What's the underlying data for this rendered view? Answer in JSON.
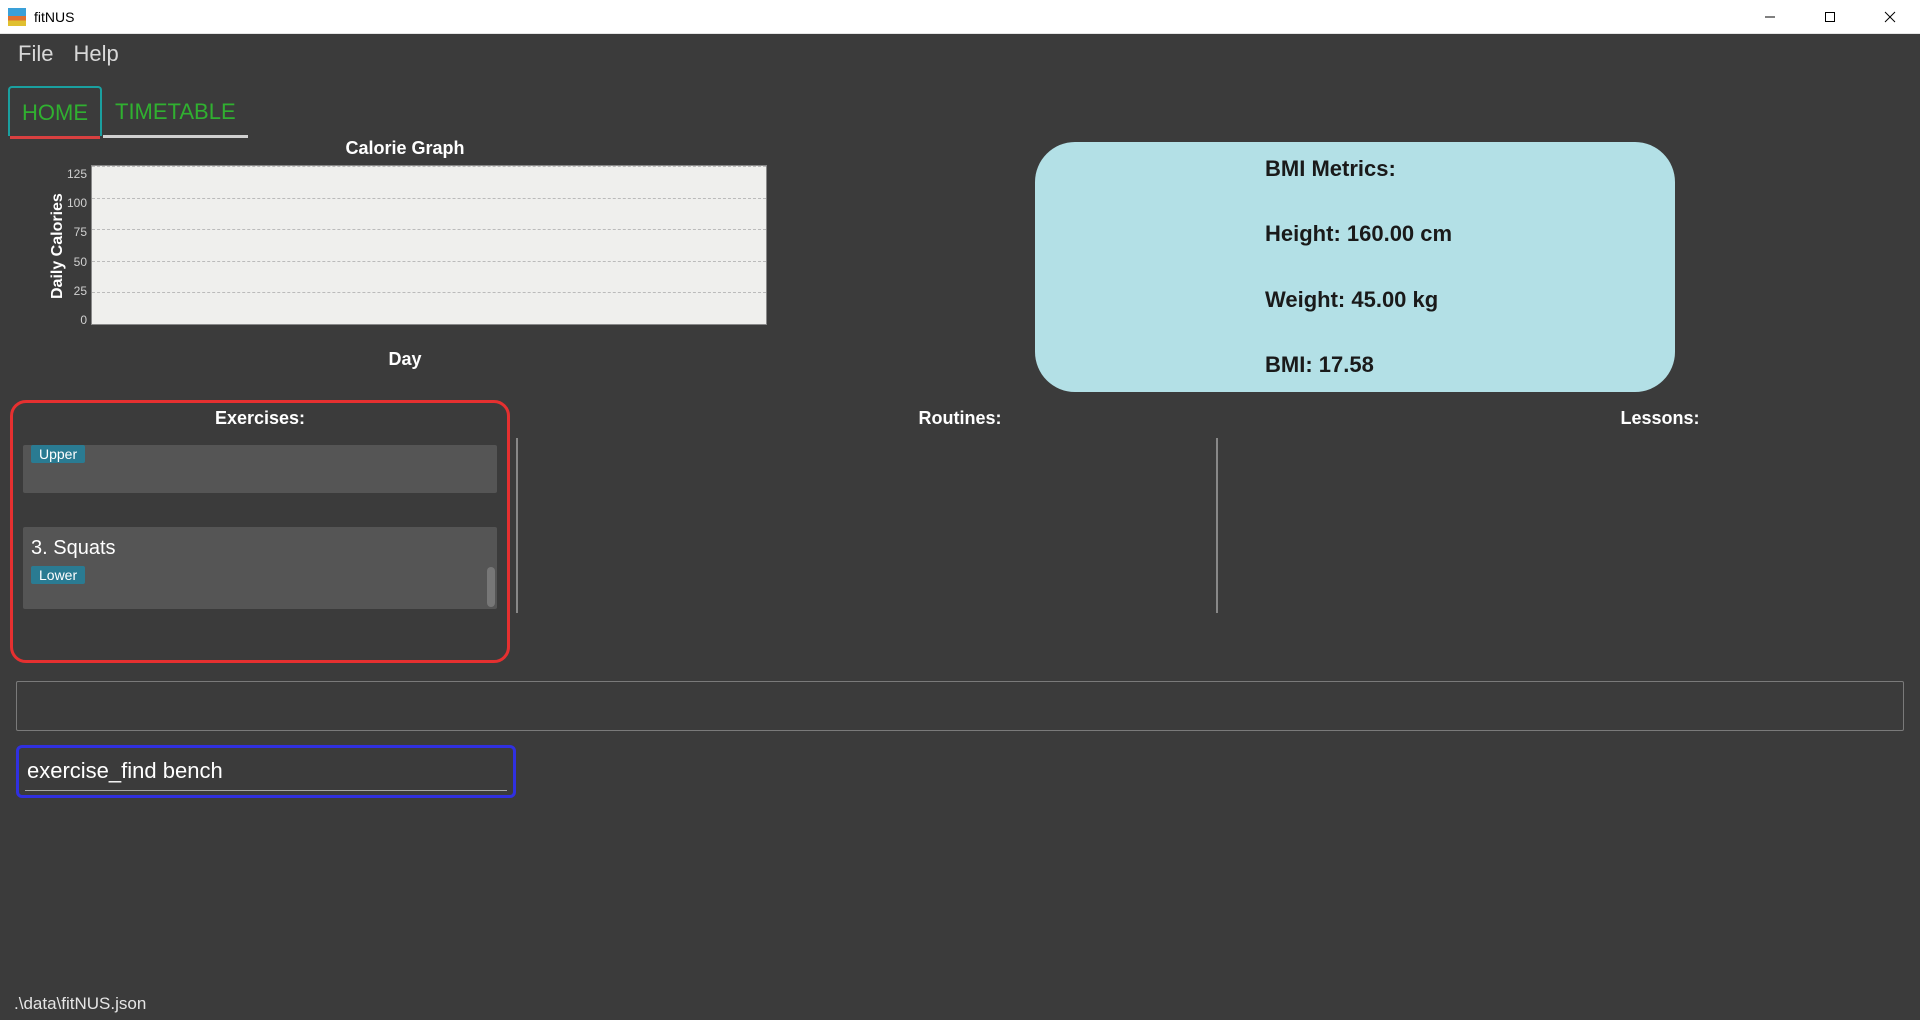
{
  "window": {
    "title": "fitNUS"
  },
  "menubar": {
    "file": "File",
    "help": "Help"
  },
  "tabs": {
    "home": "HOME",
    "timetable": "TIMETABLE"
  },
  "chart_data": {
    "type": "bar",
    "title": "Calorie Graph",
    "ylabel": "Daily Calories",
    "xlabel": "Day",
    "yticks": [
      "125",
      "100",
      "75",
      "50",
      "25",
      "0"
    ],
    "categories": [],
    "values": [],
    "ylim": [
      0,
      125
    ]
  },
  "bmi": {
    "title": "BMI Metrics:",
    "height": "Height: 160.00 cm",
    "weight": "Weight: 45.00 kg",
    "bmi": "BMI: 17.58"
  },
  "panels": {
    "exercises_title": "Exercises:",
    "routines_title": "Routines:",
    "lessons_title": "Lessons:"
  },
  "exercises": {
    "partial_tag": "Upper",
    "item3_label": "3.   Squats",
    "item3_tag": "Lower"
  },
  "command": {
    "value": "exercise_find bench"
  },
  "footer": {
    "path": ".\\data\\fitNUS.json"
  }
}
